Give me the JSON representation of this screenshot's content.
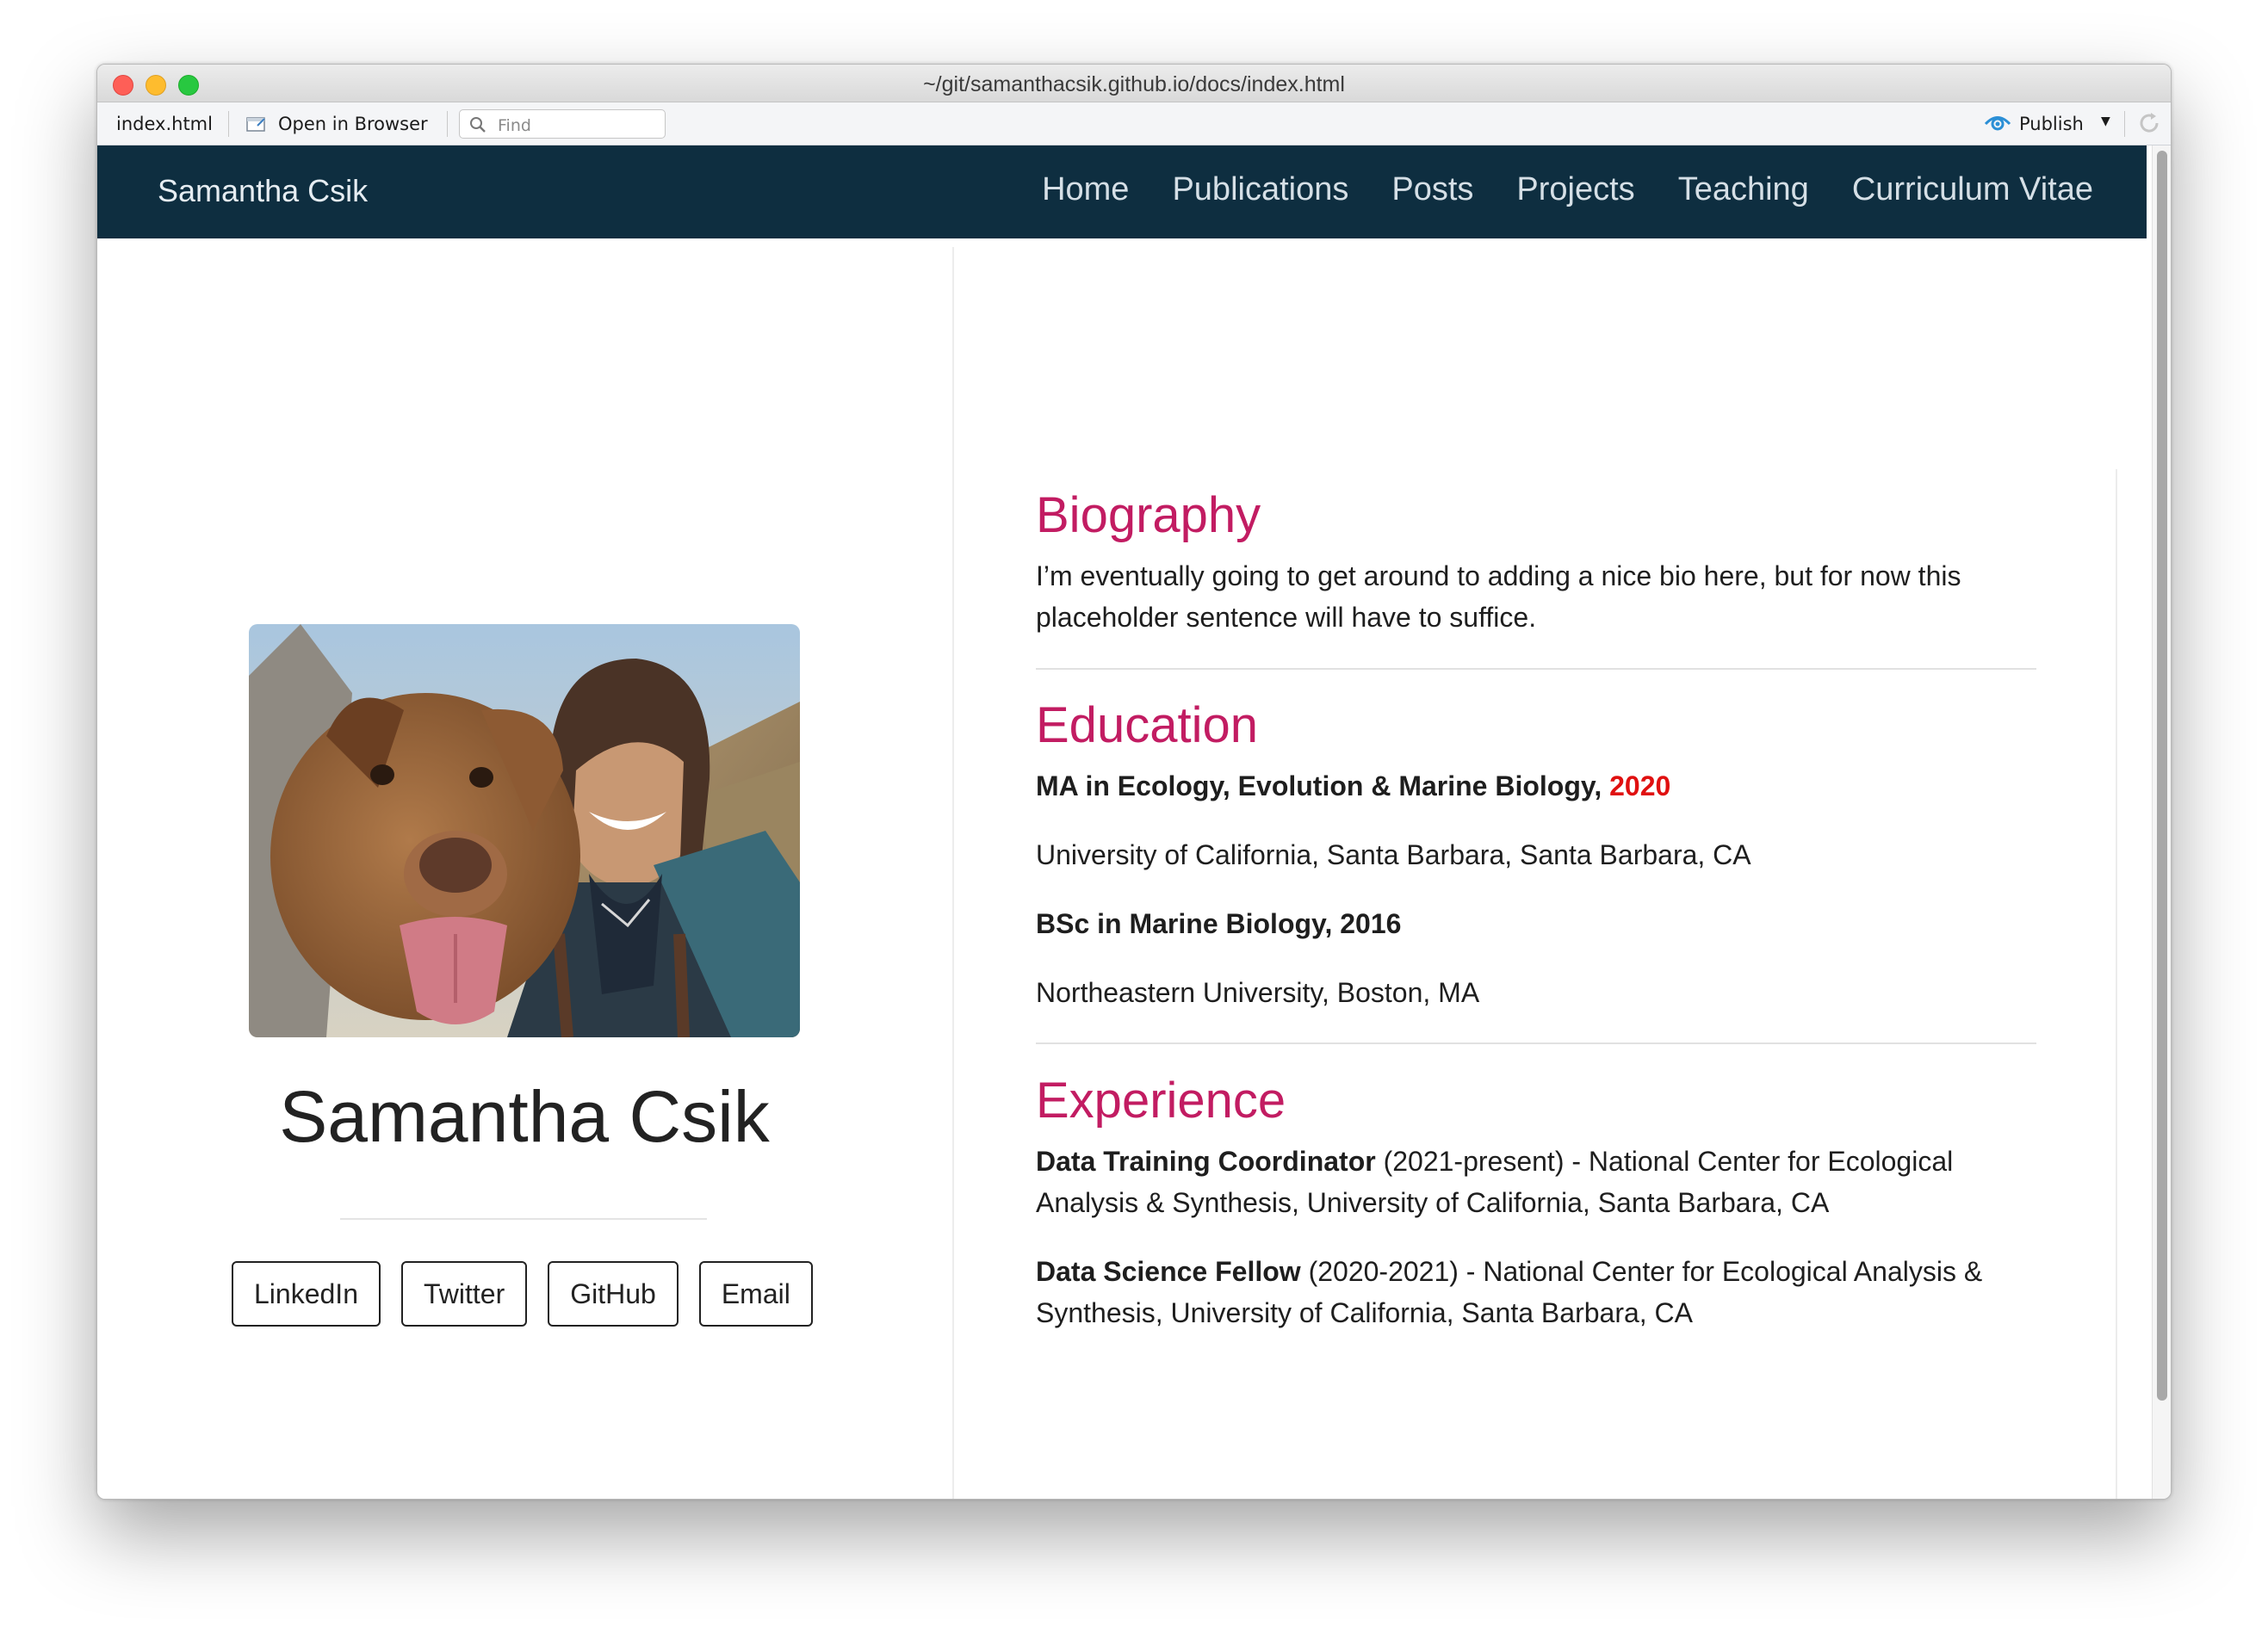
{
  "window": {
    "title": "~/git/samanthacsik.github.io/docs/index.html"
  },
  "toolbar": {
    "file_tab": "index.html",
    "open_in_browser": "Open in Browser",
    "find_placeholder": "Find",
    "publish": "Publish"
  },
  "navbar": {
    "brand": "Samantha Csik",
    "items": [
      "Home",
      "Publications",
      "Posts",
      "Projects",
      "Teaching",
      "Curriculum Vitae"
    ]
  },
  "profile": {
    "name": "Samantha Csik",
    "links": [
      "LinkedIn",
      "Twitter",
      "GitHub",
      "Email"
    ]
  },
  "biography": {
    "heading": "Biography",
    "line1": "I’m eventually going to get around to adding a nice bio here, but for now this",
    "line2": "placeholder sentence will have to suffice."
  },
  "education": {
    "heading": "Education",
    "degree1": "MA in Ecology, Evolution & Marine Biology, ",
    "degree1_year": "2020",
    "school1": "University of California, Santa Barbara, Santa Barbara, CA",
    "degree2": "BSc in Marine Biology, 2016",
    "school2": "Northeastern University, Boston, MA"
  },
  "experience": {
    "heading": "Experience",
    "job1_title": "Data Training Coordinator",
    "job1_rest_line1": " (2021-present) - National Center for Ecological",
    "job1_line2": "Analysis & Synthesis, University of California, Santa Barbara, CA",
    "job2_title": "Data Science Fellow",
    "job2_rest_line1": " (2020-2021) - National Center for Ecological Analysis &",
    "job2_line2": "Synthesis, University of California, Santa Barbara, CA"
  },
  "colors": {
    "navbar_bg": "#0e2e40",
    "heading_accent": "#c21c62",
    "year_highlight": "#e01010"
  }
}
